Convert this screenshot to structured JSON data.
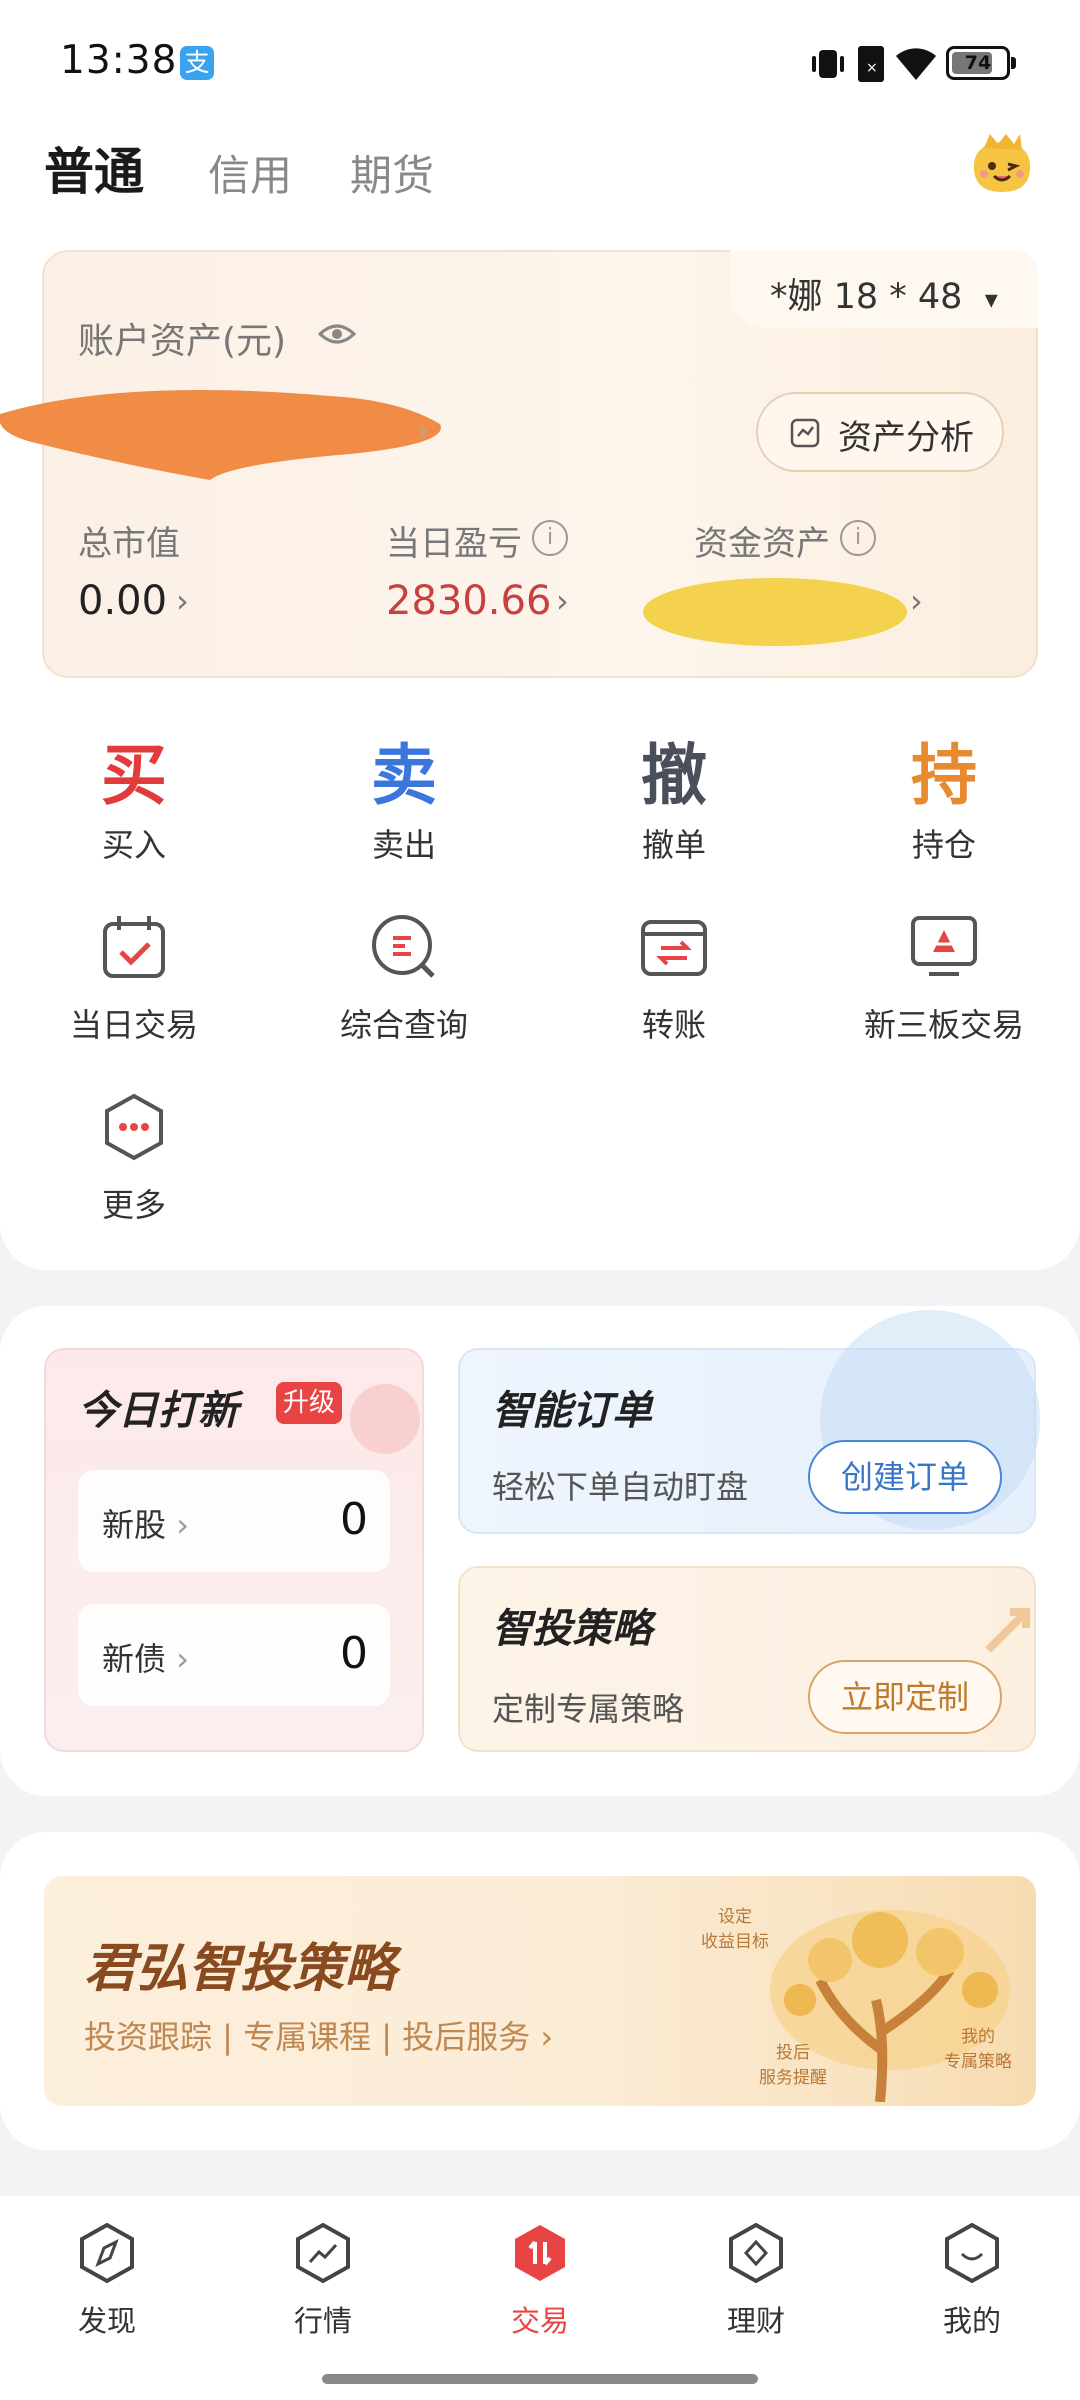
{
  "status_bar": {
    "time": "13:38",
    "app_icon": "支",
    "battery": "74"
  },
  "top_tabs": {
    "active": "普通",
    "tab2": "信用",
    "tab3": "期货"
  },
  "asset_card": {
    "account_id": "*娜 18 * 48",
    "dropdown_icon": "▾",
    "asset_label": "账户资产(元)",
    "analysis_button": "资产分析",
    "metrics": [
      {
        "label": "总市值",
        "value": "0.00"
      },
      {
        "label": "当日盈亏",
        "value": "2830.66"
      },
      {
        "label": "资金资产",
        "value": ""
      }
    ],
    "chevron": "›",
    "info": "i"
  },
  "quick_actions": [
    {
      "glyph": "买",
      "label": "买入",
      "color": "#e23b3b"
    },
    {
      "glyph": "卖",
      "label": "卖出",
      "color": "#3a76dc"
    },
    {
      "glyph": "撤",
      "label": "撤单",
      "color": "#4a4f5c"
    },
    {
      "glyph": "持",
      "label": "持仓",
      "color": "#e88a2e"
    }
  ],
  "features": [
    {
      "label": "当日交易",
      "icon": "calendar-check-icon"
    },
    {
      "label": "综合查询",
      "icon": "search-list-icon"
    },
    {
      "label": "转账",
      "icon": "transfer-icon"
    },
    {
      "label": "新三板交易",
      "icon": "monitor-chart-icon"
    },
    {
      "label": "更多",
      "icon": "more-dots-icon"
    }
  ],
  "ipo": {
    "title": "今日打新",
    "badge": "升级",
    "rows": [
      {
        "label": "新股",
        "value": "0"
      },
      {
        "label": "新债",
        "value": "0"
      }
    ]
  },
  "smart_order": {
    "title": "智能订单",
    "subtitle": "轻松下单自动盯盘",
    "button": "创建订单"
  },
  "strategy": {
    "title": "智投策略",
    "subtitle": "定制专属策略",
    "button": "立即定制"
  },
  "banner": {
    "title": "君弘智投策略",
    "subtitle": "投资跟踪 | 专属课程 | 投后服务 ›",
    "tree_labels": [
      "设定\n收益目标",
      "投后\n服务提醒",
      "我的\n专属策略"
    ]
  },
  "bottom_nav": [
    {
      "label": "发现",
      "icon": "compass-icon",
      "active": false
    },
    {
      "label": "行情",
      "icon": "trend-icon",
      "active": false
    },
    {
      "label": "交易",
      "icon": "trade-icon",
      "active": true
    },
    {
      "label": "理财",
      "icon": "diamond-icon",
      "active": false
    },
    {
      "label": "我的",
      "icon": "profile-icon",
      "active": false
    }
  ],
  "colors": {
    "accent_red": "#e84444",
    "loss_gain_red": "#c84040",
    "nav_active": "#e84444"
  }
}
